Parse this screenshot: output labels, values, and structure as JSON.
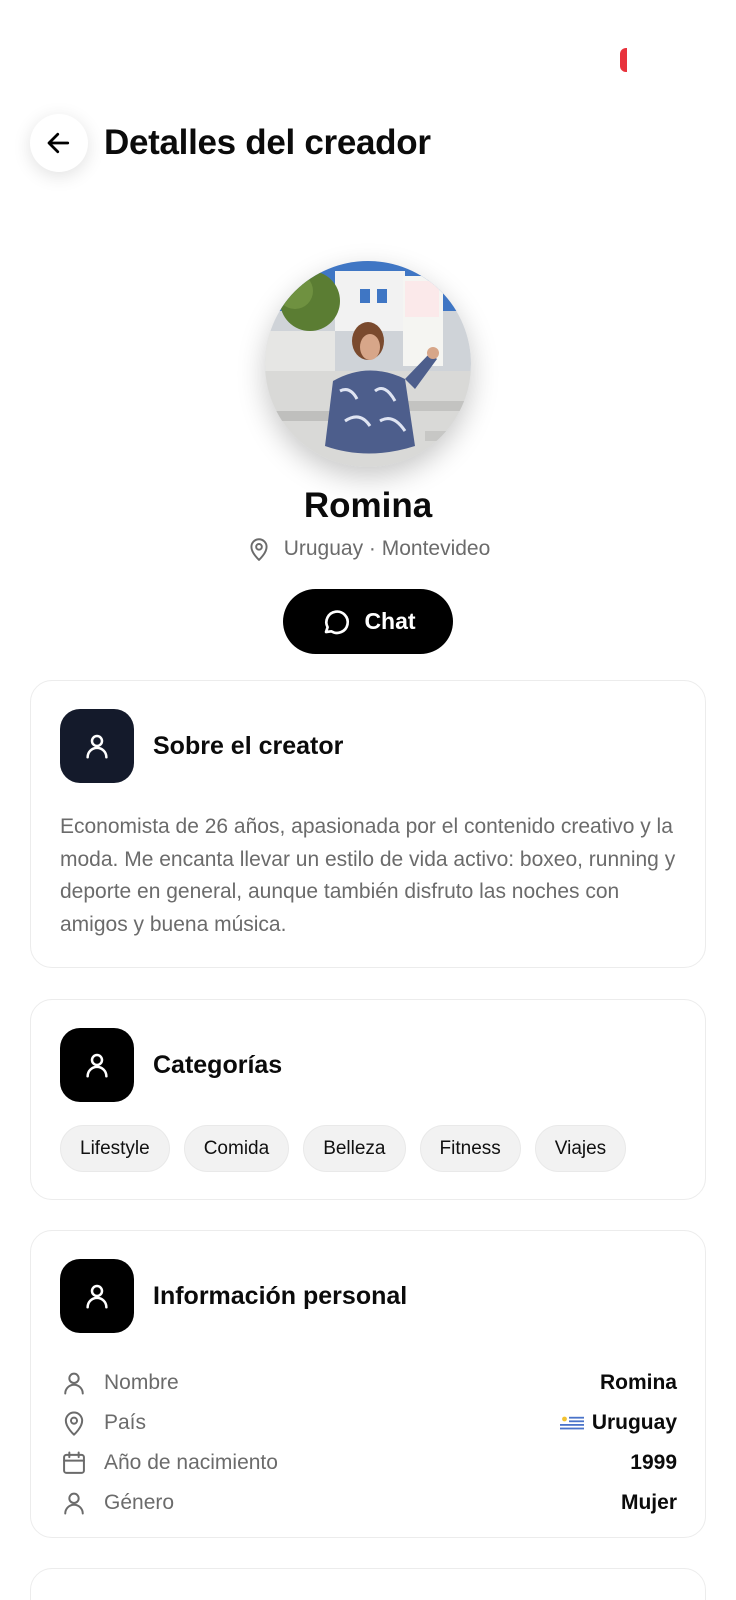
{
  "header": {
    "title": "Detalles del creador"
  },
  "creator": {
    "name": "Romina",
    "location": "Uruguay · Montevideo",
    "chat_label": "Chat"
  },
  "about": {
    "title": "Sobre el creator",
    "text": "Economista de 26 años, apasionada por el contenido creativo y la moda. Me encanta llevar un estilo de vida activo: boxeo, running y deporte en general, aunque también disfruto las noches con amigos y buena música."
  },
  "categories": {
    "title": "Categorías",
    "items": [
      "Lifestyle",
      "Comida",
      "Belleza",
      "Fitness",
      "Viajes"
    ]
  },
  "personal": {
    "title": "Información personal",
    "rows": [
      {
        "label": "Nombre",
        "value": "Romina",
        "icon": "person-icon"
      },
      {
        "label": "País",
        "value": "Uruguay",
        "icon": "location-pin-icon"
      },
      {
        "label": "Año de nacimiento",
        "value": "1999",
        "icon": "calendar-icon"
      },
      {
        "label": "Género",
        "value": "Mujer",
        "icon": "person-icon"
      }
    ]
  },
  "colors": {
    "accent": "#000000",
    "about_icon_bg": "#141a2b",
    "status_indicator": "#e8323c"
  }
}
